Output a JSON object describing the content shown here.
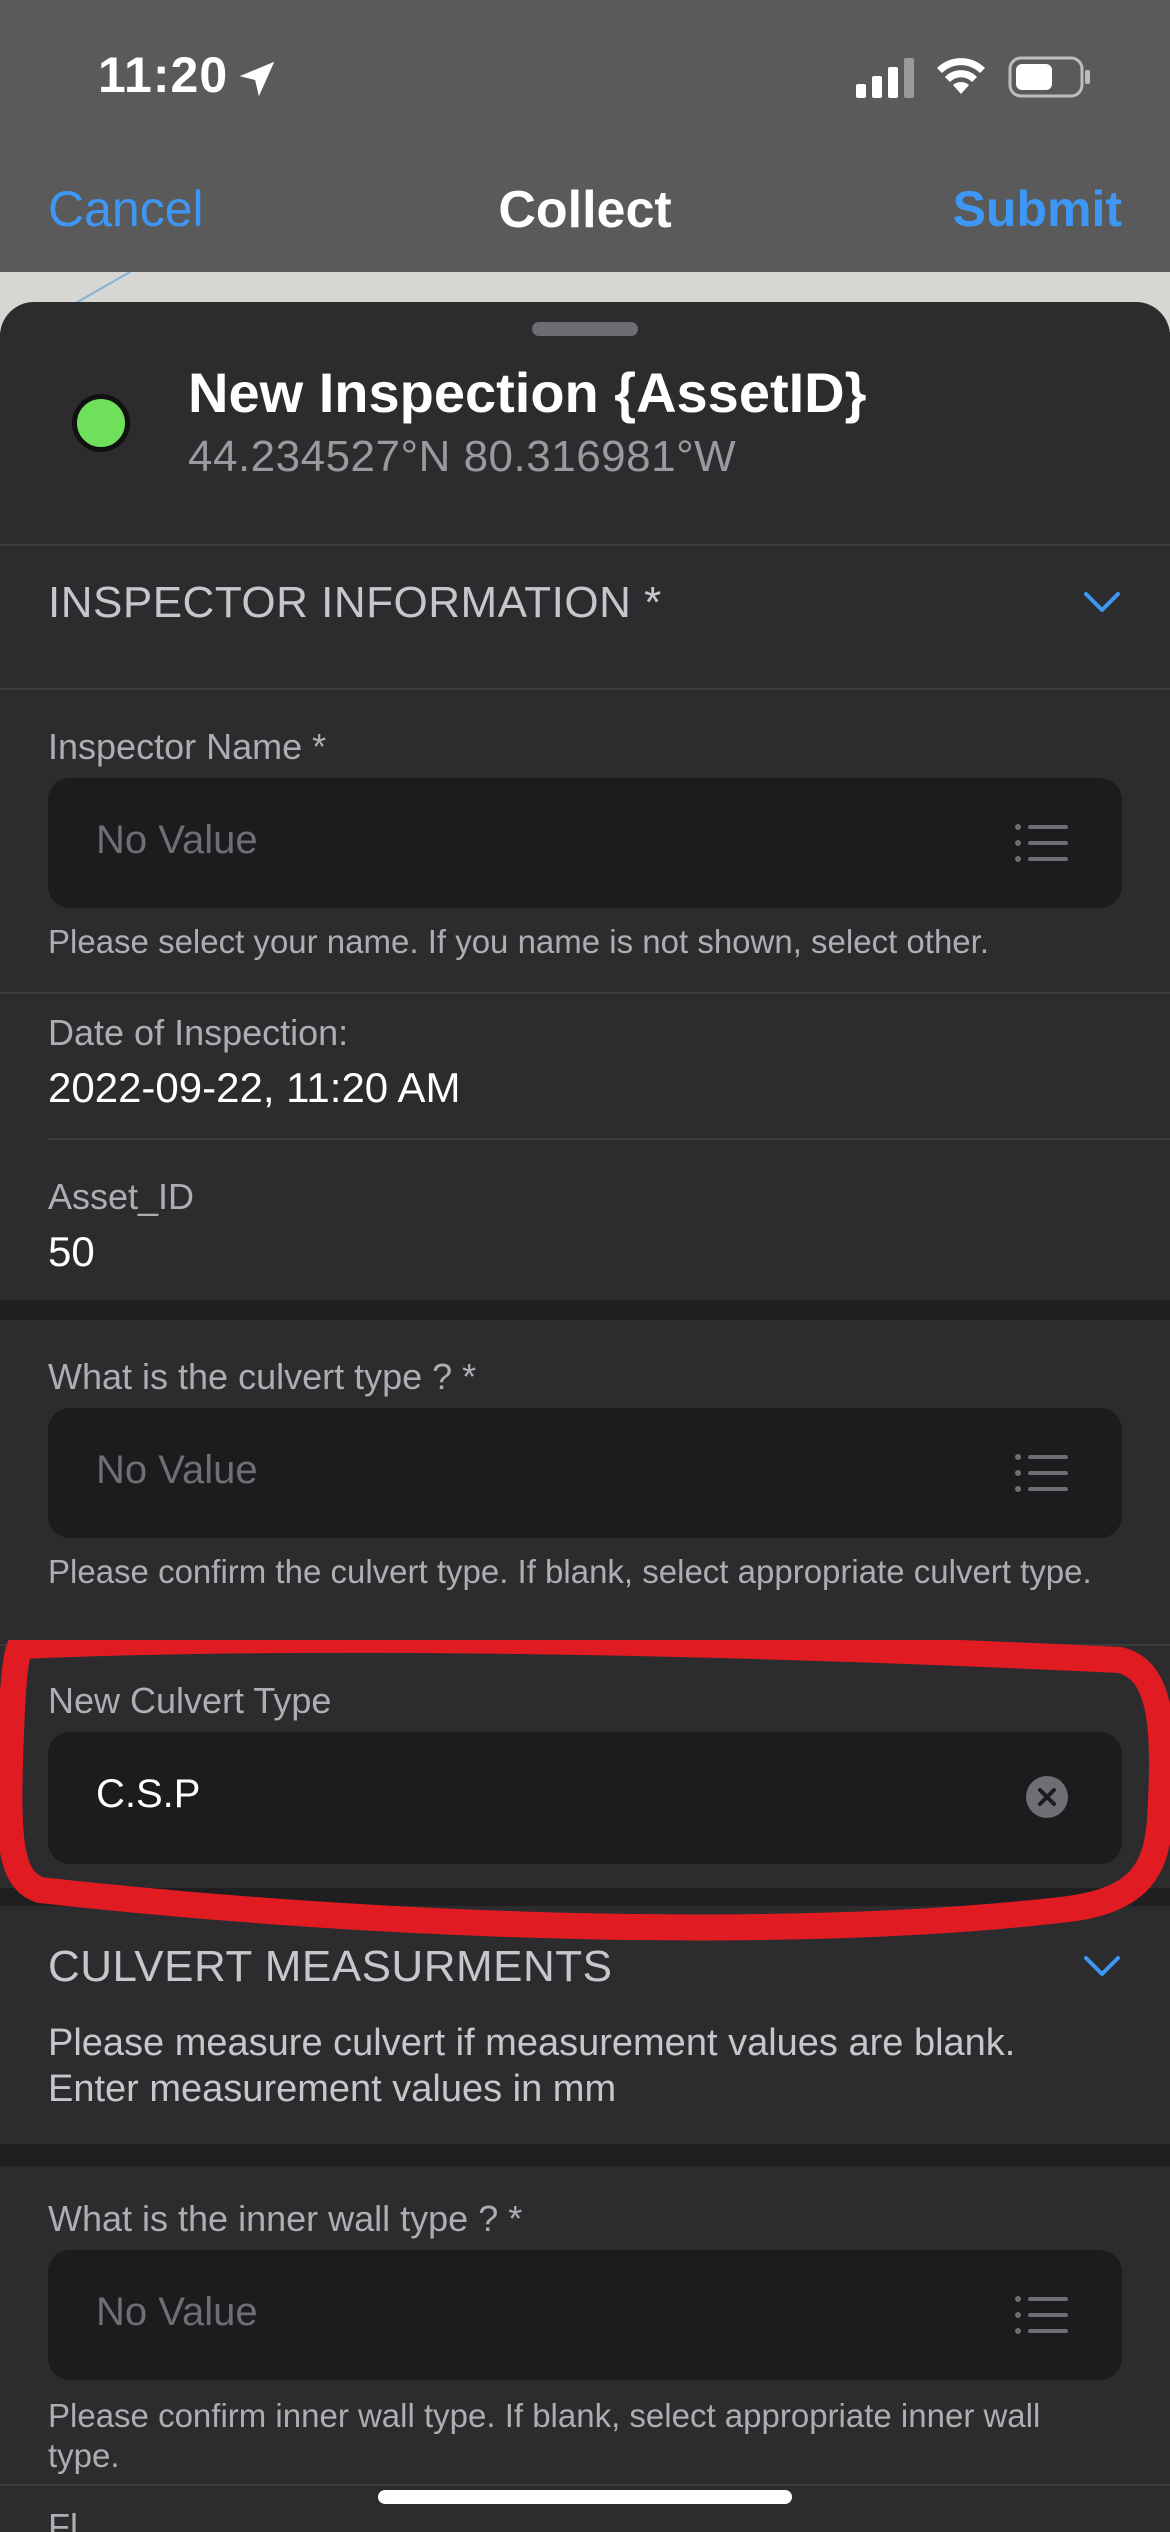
{
  "status_bar": {
    "time": "11:20"
  },
  "nav": {
    "cancel": "Cancel",
    "title": "Collect",
    "submit": "Submit"
  },
  "feature": {
    "title": "New Inspection {AssetID}",
    "coords": "44.234527°N  80.316981°W",
    "status_color": "#6ee05a"
  },
  "sections": {
    "inspector": {
      "title": "INSPECTOR INFORMATION *"
    },
    "measurements": {
      "title": "CULVERT MEASURMENTS",
      "description": "Please measure culvert if measurement values are blank. Enter measurement values in mm"
    }
  },
  "fields": {
    "inspector_name": {
      "label": "Inspector Name *",
      "placeholder": "No Value",
      "hint": "Please select your name. If you name is not shown, select other."
    },
    "date": {
      "label": "Date of Inspection:",
      "value": "2022-09-22, 11:20 AM"
    },
    "asset_id": {
      "label": "Asset_ID",
      "value": "50"
    },
    "culvert_type": {
      "label": "What is the culvert type ? *",
      "placeholder": "No Value",
      "hint": "Please confirm the culvert type. If blank, select appropriate culvert type."
    },
    "new_culvert_type": {
      "label": "New Culvert Type",
      "value": "C.S.P"
    },
    "inner_wall_type": {
      "label": "What is the inner wall type ? *",
      "placeholder": "No Value",
      "hint": "Please confirm inner wall type. If blank, select appropriate inner wall type."
    },
    "next_label_partial": "Fl..."
  },
  "colors": {
    "accent": "#3e97f4",
    "annotation": "#e11b22",
    "sheet_bg": "#2c2c2e"
  }
}
